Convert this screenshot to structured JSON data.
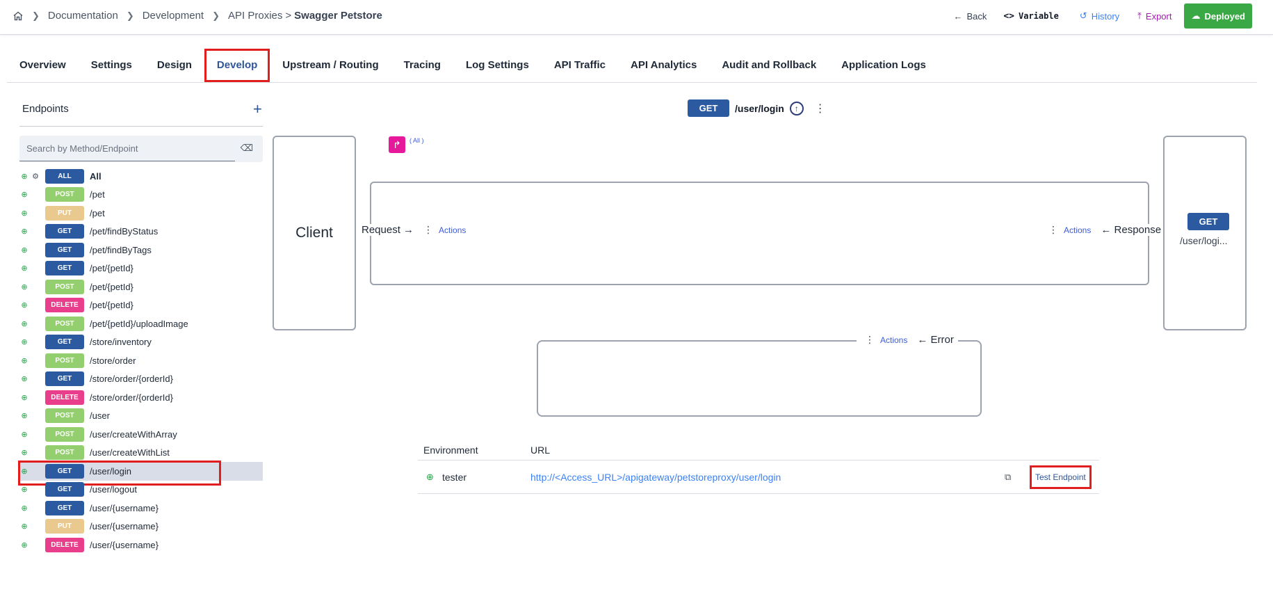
{
  "breadcrumb": {
    "items": [
      "Documentation",
      "Development",
      "API Proxies"
    ],
    "separator": ">",
    "current": "Swagger Petstore"
  },
  "top_actions": {
    "back": "Back",
    "variable": "Variable",
    "history": "History",
    "export": "Export",
    "deployed": "Deployed"
  },
  "tabs": [
    {
      "label": "Overview",
      "active": false
    },
    {
      "label": "Settings",
      "active": false
    },
    {
      "label": "Design",
      "active": false
    },
    {
      "label": "Develop",
      "active": true
    },
    {
      "label": "Upstream / Routing",
      "active": false
    },
    {
      "label": "Tracing",
      "active": false
    },
    {
      "label": "Log Settings",
      "active": false
    },
    {
      "label": "API Traffic",
      "active": false
    },
    {
      "label": "API Analytics",
      "active": false
    },
    {
      "label": "Audit and Rollback",
      "active": false
    },
    {
      "label": "Application Logs",
      "active": false
    }
  ],
  "sidebar": {
    "title": "Endpoints",
    "add": "+",
    "search_placeholder": "Search by Method/Endpoint",
    "endpoints": [
      {
        "method": "ALL",
        "path": "All"
      },
      {
        "method": "POST",
        "path": "/pet"
      },
      {
        "method": "PUT",
        "path": "/pet"
      },
      {
        "method": "GET",
        "path": "/pet/findByStatus"
      },
      {
        "method": "GET",
        "path": "/pet/findByTags"
      },
      {
        "method": "GET",
        "path": "/pet/{petId}"
      },
      {
        "method": "POST",
        "path": "/pet/{petId}"
      },
      {
        "method": "DELETE",
        "path": "/pet/{petId}"
      },
      {
        "method": "POST",
        "path": "/pet/{petId}/uploadImage"
      },
      {
        "method": "GET",
        "path": "/store/inventory"
      },
      {
        "method": "POST",
        "path": "/store/order"
      },
      {
        "method": "GET",
        "path": "/store/order/{orderId}"
      },
      {
        "method": "DELETE",
        "path": "/store/order/{orderId}"
      },
      {
        "method": "POST",
        "path": "/user"
      },
      {
        "method": "POST",
        "path": "/user/createWithArray"
      },
      {
        "method": "POST",
        "path": "/user/createWithList"
      },
      {
        "method": "GET",
        "path": "/user/login",
        "selected": true
      },
      {
        "method": "GET",
        "path": "/user/logout"
      },
      {
        "method": "GET",
        "path": "/user/{username}"
      },
      {
        "method": "PUT",
        "path": "/user/{username}"
      },
      {
        "method": "DELETE",
        "path": "/user/{username}"
      }
    ]
  },
  "flow": {
    "method": "GET",
    "path": "/user/login",
    "client_label": "Client",
    "all_tag": "( All )",
    "request_label": "Request →",
    "response_label": "← Response",
    "error_label": "← Error",
    "actions_label": "Actions",
    "backend_method": "GET",
    "backend_path": "/user/logi..."
  },
  "environment_table": {
    "headers": [
      "Environment",
      "URL"
    ],
    "rows": [
      {
        "environment": "tester",
        "url": "http://<Access_URL>/apigateway/petstoreproxy/user/login",
        "action": "Test Endpoint"
      }
    ]
  },
  "colors": {
    "get": "#2c5aa0",
    "post": "#93cf6e",
    "put": "#e9c98d",
    "delete": "#e83e8c",
    "deployed": "#3aa845",
    "highlight": "#e11d1d"
  }
}
